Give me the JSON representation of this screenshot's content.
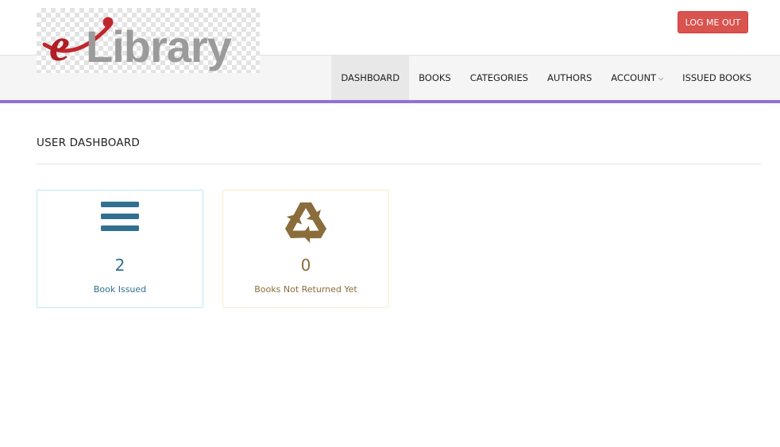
{
  "app": {
    "logo_text": "eLibrary",
    "logout_label": "LOG ME OUT"
  },
  "nav": {
    "items": [
      {
        "label": "DASHBOARD"
      },
      {
        "label": "BOOKS"
      },
      {
        "label": "CATEGORIES"
      },
      {
        "label": "AUTHORS"
      },
      {
        "label": "ACCOUNT"
      },
      {
        "label": "ISSUED BOOKS"
      }
    ],
    "active": "DASHBOARD",
    "account_icon": "chevron-down-icon"
  },
  "page": {
    "title": "USER DASHBOARD"
  },
  "cards": {
    "issued": {
      "count": "2",
      "label": "Book Issued",
      "icon": "bars-icon"
    },
    "not_returned": {
      "count": "0",
      "label": "Books Not Returned Yet",
      "icon": "recycle-icon"
    }
  },
  "colors": {
    "accent": "#9370db",
    "logout": "#d9534f",
    "info": "#31708f",
    "warning": "#8a6d3b"
  }
}
